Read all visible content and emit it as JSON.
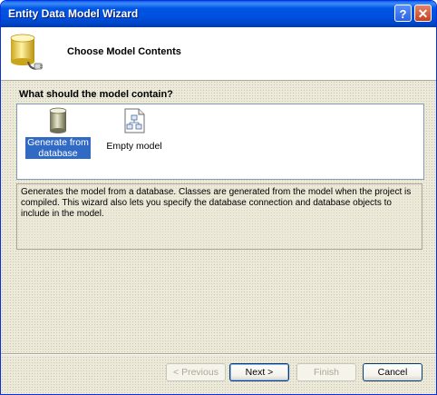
{
  "window": {
    "title": "Entity Data Model Wizard",
    "help_label": "?",
    "close_label": "✕"
  },
  "header": {
    "title": "Choose Model Contents",
    "icon": "database-wizard-icon"
  },
  "content": {
    "question": "What should the model contain?",
    "options": [
      {
        "label": "Generate from database",
        "icon": "database-icon",
        "selected": true
      },
      {
        "label": "Empty model",
        "icon": "empty-model-icon",
        "selected": false
      }
    ],
    "description": "Generates the model from a database. Classes are generated from the model when the project is compiled. This wizard also lets you specify the database connection and database objects to include in the model."
  },
  "buttons": {
    "previous": "< Previous",
    "next": "Next >",
    "finish": "Finish",
    "cancel": "Cancel"
  },
  "colors": {
    "titlebar": "#0055e5",
    "selection": "#316ac5",
    "dialog_bg": "#ece9d8"
  }
}
